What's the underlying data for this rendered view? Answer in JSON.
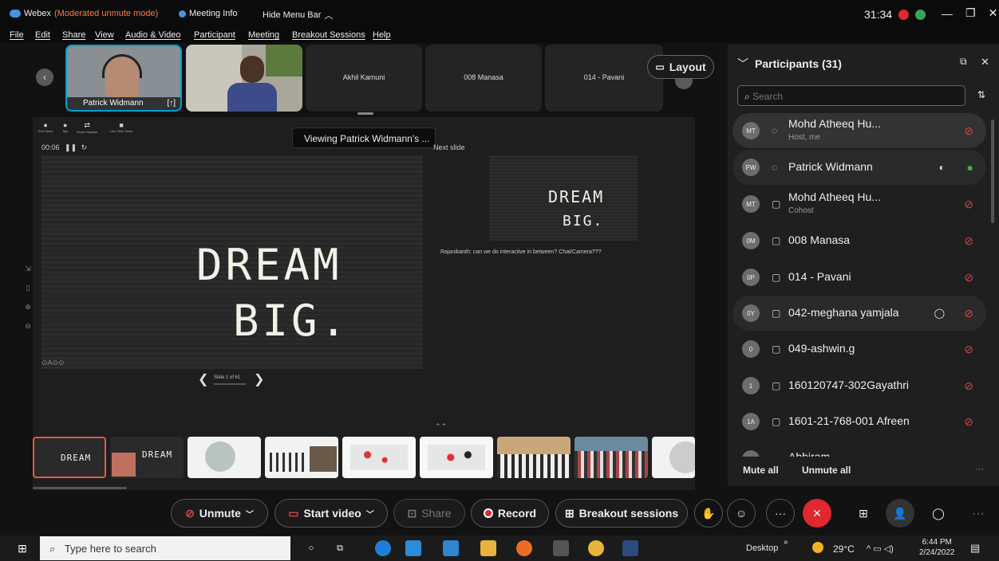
{
  "titlebar": {
    "app": "Webex",
    "mode": "(Moderated unmute mode)",
    "meeting_info": "Meeting Info",
    "hide_menu": "Hide Menu Bar",
    "timer": "31:34"
  },
  "menu": [
    "File",
    "Edit",
    "Share",
    "View",
    "Audio & Video",
    "Participant",
    "Meeting",
    "Breakout Sessions",
    "Help"
  ],
  "video_strip": {
    "tiles": [
      "Patrick Widmann",
      "Akhil Kamuni",
      "008 Manasa",
      "014 - Pavani"
    ],
    "layout_label": "Layout"
  },
  "stage": {
    "tooltip": "Viewing Patrick Widmann's ...",
    "tools": [
      "End Show",
      "Tips",
      "Swap Displays",
      "Use Slide Show"
    ],
    "timer": "00:06",
    "next_slide_label": "Next slide",
    "slide_text_line1": "DREAM",
    "slide_text_line2": "BIG.",
    "note": "Rajanikanth: can we do interactive in between? Chat/Camera???",
    "slide_counter": "Slide 1 of 61"
  },
  "participants": {
    "title": "Participants (31)",
    "search_placeholder": "Search",
    "rows": [
      {
        "initials": "MT",
        "name": "Mohd Atheeq Hu...",
        "sub": "Host, me"
      },
      {
        "initials": "PW",
        "name": "Patrick Widmann",
        "sub": ""
      },
      {
        "initials": "MT",
        "name": "Mohd Atheeq Hu...",
        "sub": "Cohost"
      },
      {
        "initials": "0M",
        "name": "008 Manasa",
        "sub": ""
      },
      {
        "initials": "0P",
        "name": "014 - Pavani",
        "sub": ""
      },
      {
        "initials": "0Y",
        "name": "042-meghana yamjala",
        "sub": ""
      },
      {
        "initials": "0",
        "name": "049-ashwin.g",
        "sub": ""
      },
      {
        "initials": "1",
        "name": "160120747-302Gayathri",
        "sub": ""
      },
      {
        "initials": "1A",
        "name": "1601-21-768-001 Afreen",
        "sub": ""
      },
      {
        "initials": "A",
        "name": "Abhiram",
        "sub": ""
      }
    ],
    "mute_all": "Mute all",
    "unmute_all": "Unmute all"
  },
  "controls": {
    "unmute": "Unmute",
    "start_video": "Start video",
    "share": "Share",
    "record": "Record",
    "breakout": "Breakout sessions"
  },
  "taskbar": {
    "search": "Type here to search",
    "desktop": "Desktop",
    "weather": "29°C",
    "time": "6:44 PM",
    "date": "2/24/2022"
  },
  "colors": {
    "accent": "#00a0d1",
    "leave": "#e0282e",
    "muted": "#d64545",
    "unmuted": "#4caf50"
  }
}
